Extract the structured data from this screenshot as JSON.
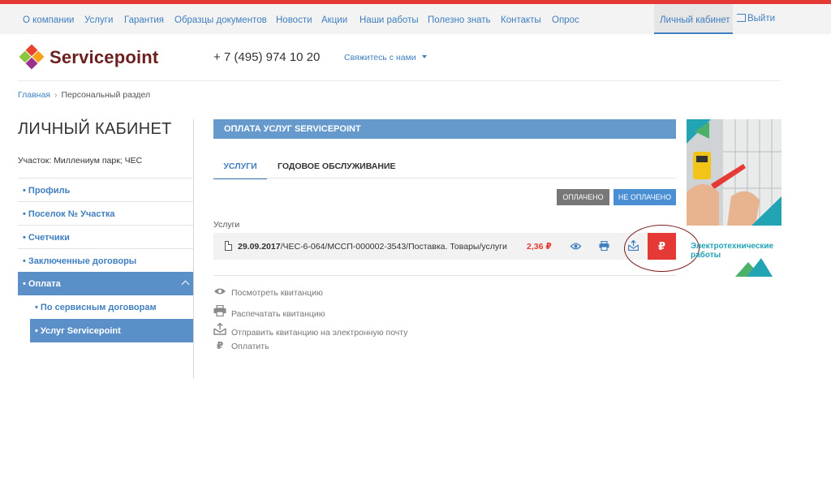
{
  "topnav": {
    "items": [
      "О компании",
      "Услуги",
      "Гарантия",
      "Образцы документов",
      "Новости",
      "Акции",
      "Наши работы",
      "Полезно знать",
      "Контакты",
      "Опрос"
    ],
    "cabinet": "Личный кабинет",
    "logout": "Выйти"
  },
  "header": {
    "brand": "Servicepoint",
    "phone": "+ 7 (495) 974 10 20",
    "contact": "Свяжитесь с нами"
  },
  "breadcrumb": {
    "home": "Главная",
    "current": "Персональный раздел"
  },
  "sidebar": {
    "title": "ЛИЧНЫЙ КАБИНЕТ",
    "plot": "Участок: Миллениум парк; ЧЕС",
    "items": [
      "• Профиль",
      "• Поселок № Участка",
      "• Счетчики",
      "• Заключенные договоры",
      "• Оплата"
    ],
    "subitems": [
      "• По сервисным договорам",
      "• Услуг Servicepoint"
    ]
  },
  "panel": {
    "title": "ОПЛАТА УСЛУГ SERVICEPOINT",
    "tabs": [
      "УСЛУГИ",
      "ГОДОВОЕ ОБСЛУЖИВАНИЕ"
    ],
    "filter_paid": "ОПЛАЧЕНО",
    "filter_unpaid": "НЕ ОПЛАЧЕНО",
    "section_label": "Услуги",
    "row": {
      "date": "29.09.2017",
      "description": "/ЧЕС-6-064/МССП-000002-3543/Поставка. Товары/услуги",
      "amount": "2,36 ₽",
      "pay_symbol": "₽"
    },
    "legend": [
      "Посмотреть квитанцию",
      "Распечатать квитанцию",
      "Отправить квитанцию на электронную почту",
      "Оплатить"
    ]
  },
  "banner": {
    "caption": "Электротехнические работы"
  },
  "colors": {
    "accent_blue": "#3f7fbf",
    "panel_blue": "#6699cc",
    "red": "#e53935",
    "brand": "#6b1f1f",
    "teal": "#23a4b5"
  },
  "icons": [
    "eye-icon",
    "printer-icon",
    "mail-send-icon",
    "ruble-icon",
    "document-icon",
    "logout-icon",
    "chevron-up-icon",
    "caret-down-icon"
  ]
}
